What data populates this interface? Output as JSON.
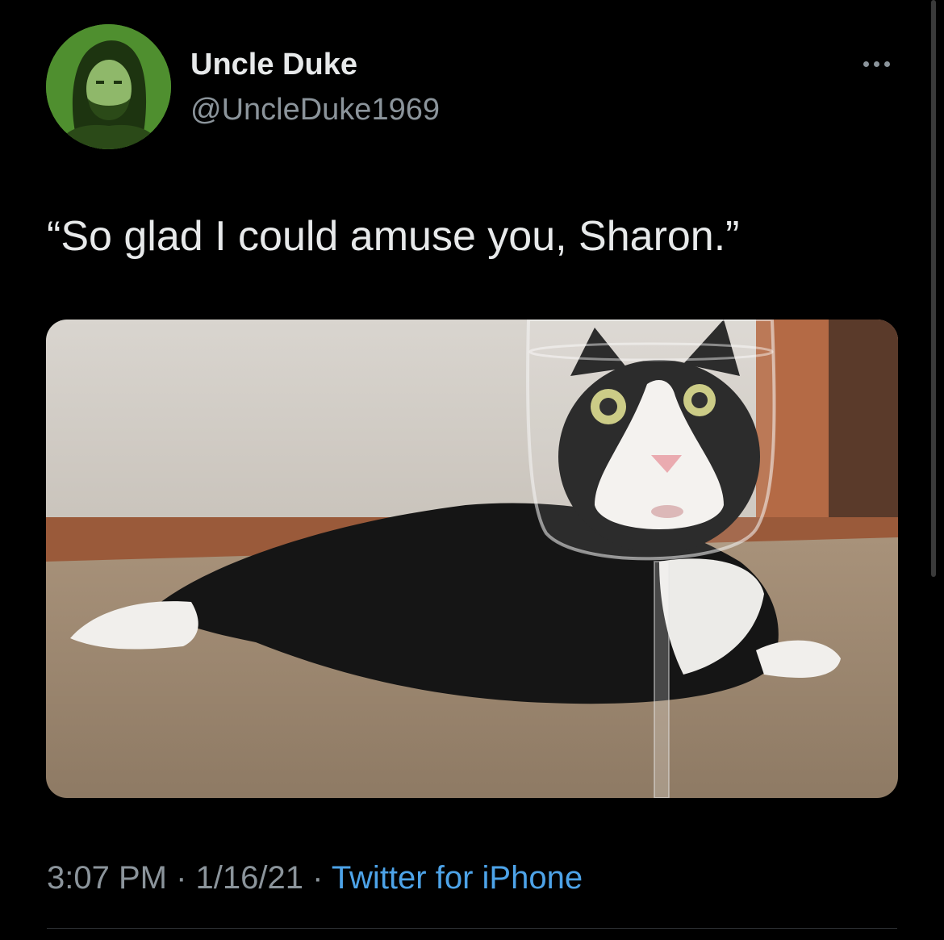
{
  "tweet": {
    "author": {
      "display_name": "Uncle Duke",
      "handle": "@UncleDuke1969",
      "avatar_icon": "profile-photo"
    },
    "more_icon": "more-options-icon",
    "text": "“So glad I could amuse you, Sharon.”",
    "media_icon": "photo",
    "meta": {
      "time": "3:07 PM",
      "separator": " · ",
      "date": "1/16/21",
      "source": "Twitter for iPhone"
    }
  },
  "colors": {
    "background": "#000000",
    "text": "#e7e9ea",
    "secondary": "#8b949b",
    "link": "#4da3e8",
    "avatar_bg": "#4f8f2f"
  }
}
